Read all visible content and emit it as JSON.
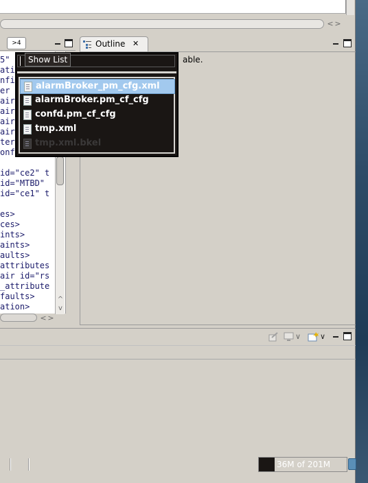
{
  "top_scroll": {
    "left_arrow": "<",
    "right_arrow": ">"
  },
  "left_panel": {
    "terminal_tab_label": ">4",
    "code_lines": [
      "5\"",
      "atio",
      "nfig",
      "er",
      "air",
      "air",
      "air",
      "air",
      "ter",
      "onfi",
      "",
      "id=\"ce2\" t",
      "id=\"MTBD\"",
      "id=\"ce1\" t",
      "",
      "es>",
      "ces>",
      "ints>",
      "aints>",
      "aults>",
      "attributes",
      "air id=\"rs",
      "_attribute",
      "faults>",
      "ation>"
    ],
    "scroll_up": "^",
    "scroll_down": "v",
    "hscroll_left": "<",
    "hscroll_right": ">"
  },
  "outline": {
    "tab_label": "Outline",
    "close": "✕",
    "message_fragment": "able."
  },
  "popup": {
    "tooltip": "Show List",
    "filter_value": "",
    "items": [
      {
        "label": "alarmBroker_pm_cfg.xml",
        "selected": true
      },
      {
        "label": "alarmBroker.pm_cf_cfg",
        "selected": false
      },
      {
        "label": "confd.pm_cf_cfg",
        "selected": false
      },
      {
        "label": "tmp.xml",
        "selected": false
      },
      {
        "label": "tmp.xml.bkel",
        "selected": false
      }
    ]
  },
  "bottom_panel": {
    "dropdown_arrow": "∨"
  },
  "status": {
    "heap_text": "36M of 201M",
    "heap_used_fraction": 0.18
  }
}
